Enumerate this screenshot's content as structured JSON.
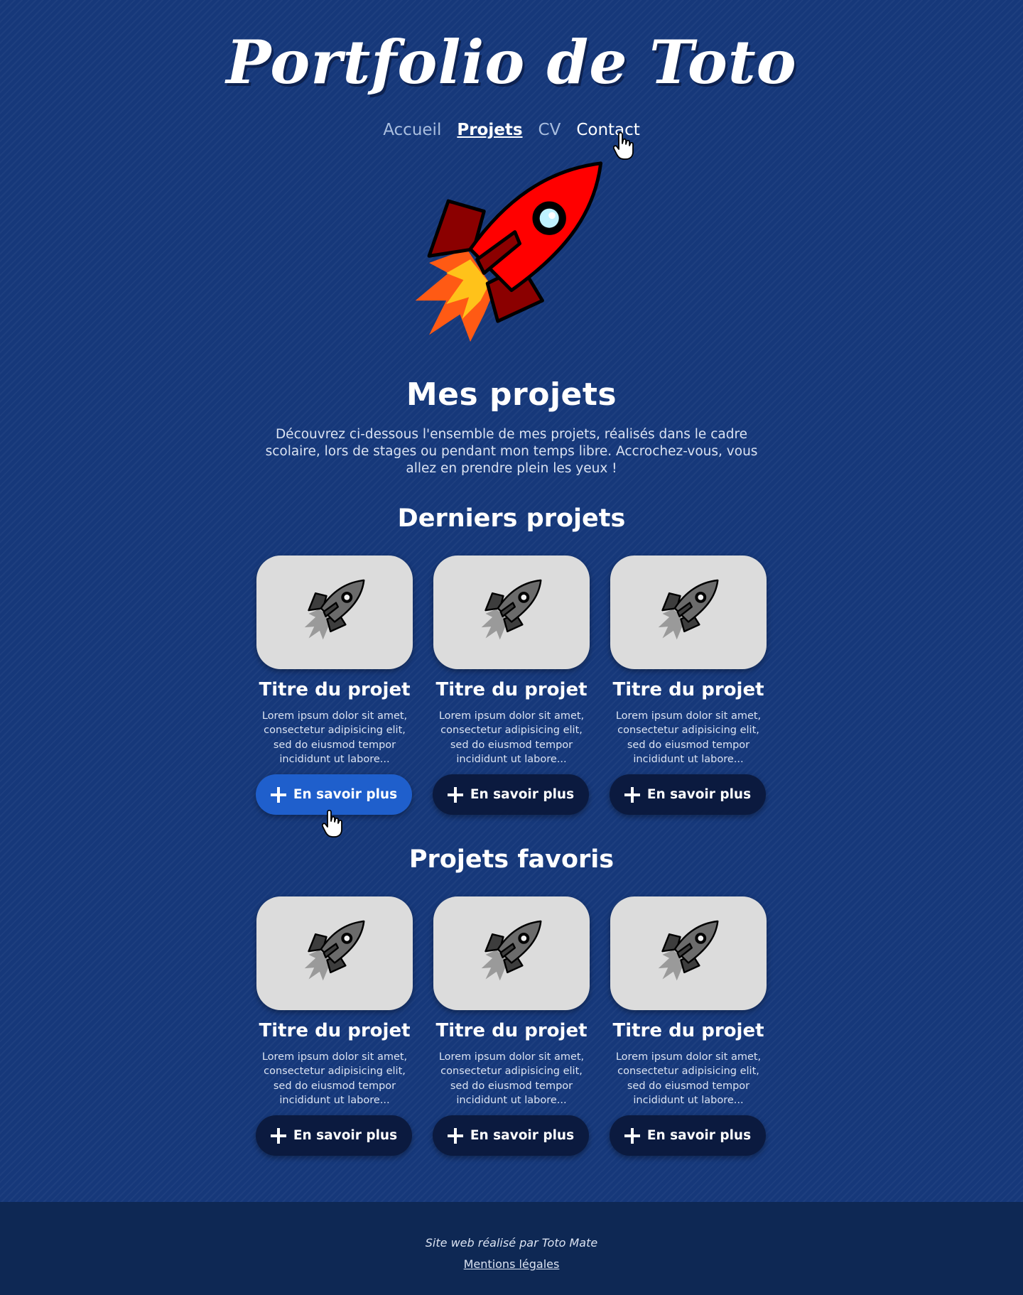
{
  "header": {
    "title": "Portfolio de Toto",
    "nav": [
      {
        "label": "Accueil",
        "state": "default"
      },
      {
        "label": "Projets",
        "state": "active"
      },
      {
        "label": "CV",
        "state": "default"
      },
      {
        "label": "Contact",
        "state": "hover"
      }
    ]
  },
  "hero": {
    "icon": "rocket-icon",
    "heading": "Mes projets",
    "intro": "Découvrez ci-dessous l'ensemble de mes projets, réalisés dans le cadre scolaire, lors de stages ou pendant mon temps libre. Accrochez-vous, vous allez en prendre plein les yeux !"
  },
  "latest": {
    "heading": "Derniers projets",
    "cards": [
      {
        "icon": "rocket-icon",
        "title": "Titre du projet",
        "description": "Lorem ipsum dolor sit amet, consectetur adipisicing elit, sed do eiusmod tempor incididunt ut labore...",
        "button": "En savoir plus",
        "button_state": "hover"
      },
      {
        "icon": "rocket-icon",
        "title": "Titre du projet",
        "description": "Lorem ipsum dolor sit amet, consectetur adipisicing elit, sed do eiusmod tempor incididunt ut labore...",
        "button": "En savoir plus",
        "button_state": "default"
      },
      {
        "icon": "rocket-icon",
        "title": "Titre du projet",
        "description": "Lorem ipsum dolor sit amet, consectetur adipisicing elit, sed do eiusmod tempor incididunt ut labore...",
        "button": "En savoir plus",
        "button_state": "default"
      }
    ]
  },
  "favorites": {
    "heading": "Projets favoris",
    "cards": [
      {
        "icon": "rocket-icon",
        "title": "Titre du projet",
        "description": "Lorem ipsum dolor sit amet, consectetur adipisicing elit, sed do eiusmod tempor incididunt ut labore...",
        "button": "En savoir plus",
        "button_state": "default"
      },
      {
        "icon": "rocket-icon",
        "title": "Titre du projet",
        "description": "Lorem ipsum dolor sit amet, consectetur adipisicing elit, sed do eiusmod tempor incididunt ut labore...",
        "button": "En savoir plus",
        "button_state": "default"
      },
      {
        "icon": "rocket-icon",
        "title": "Titre du projet",
        "description": "Lorem ipsum dolor sit amet, consectetur adipisicing elit, sed do eiusmod tempor incididunt ut labore...",
        "button": "En savoir plus",
        "button_state": "default"
      }
    ]
  },
  "footer": {
    "credit": "Site web réalisé par Toto Mate",
    "legal_link": "Mentions légales"
  },
  "colors": {
    "background": "#16387a",
    "footer": "#0e2854",
    "button": "#0b1a3f",
    "button_hover": "#1f5fcc",
    "card_image_bg": "#dcdcdc",
    "rocket_body": "#ff0000",
    "rocket_fin": "#8b0000",
    "flame": "#ff5a14"
  }
}
